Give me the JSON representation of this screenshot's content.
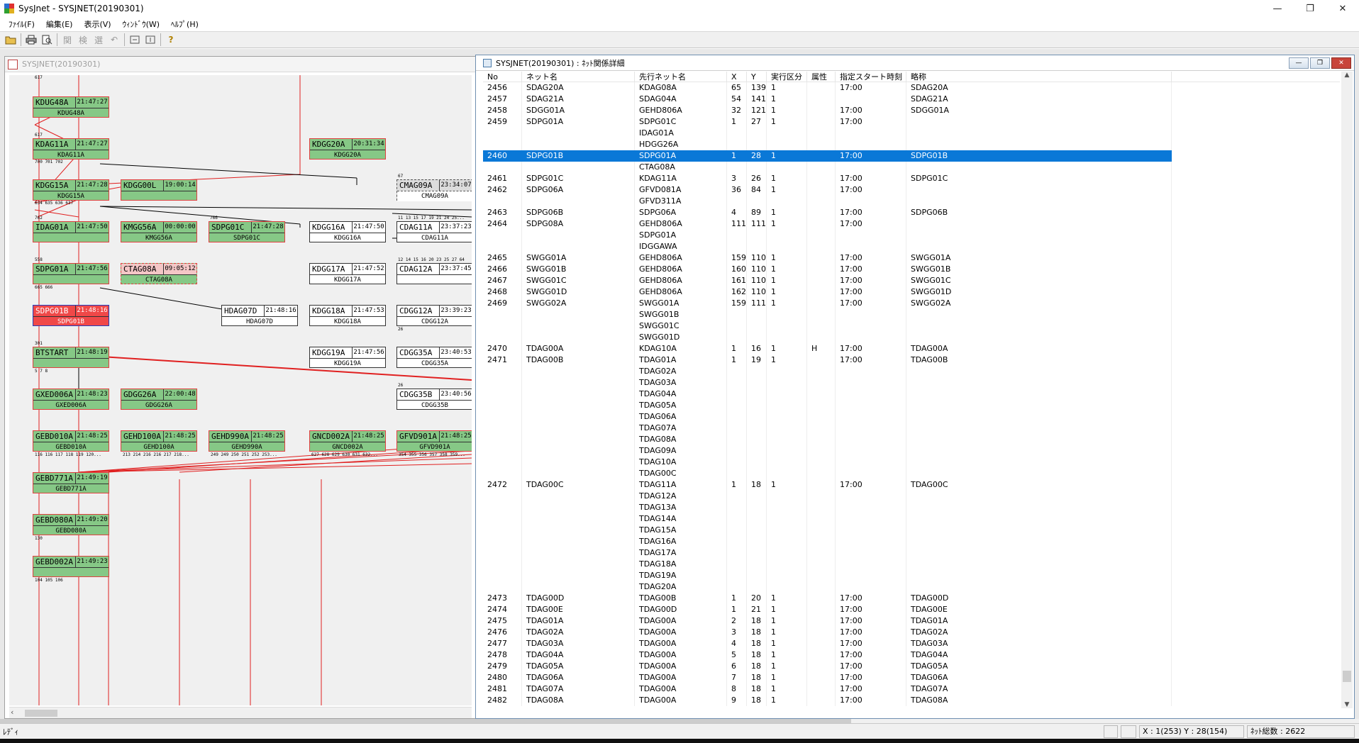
{
  "app": {
    "title": "SysJnet - SYSJNET(20190301)",
    "colors": {
      "accent": "#0a78d7",
      "node_green": "#86c886",
      "node_red": "#f04848",
      "line_red": "#e02020"
    }
  },
  "menu": [
    "ﾌｧｲﾙ(F)",
    "編集(E)",
    "表示(V)",
    "ｳｨﾝﾄﾞｳ(W)",
    "ﾍﾙﾌﾟ(H)"
  ],
  "toolbar": {
    "icons": [
      "open-folder-icon",
      "print-icon",
      "print-preview-icon",
      "relation-icon",
      "search-icon",
      "select-icon",
      "undo-icon",
      "box1-icon",
      "box2-icon",
      "help-icon"
    ],
    "glyphs": {
      "relation": "関",
      "search": "検",
      "select": "選",
      "undo": "↶",
      "help": "?"
    }
  },
  "left_window": {
    "title": "SYSJNET(20190301)",
    "nodes": [
      {
        "name": "KDUG48A",
        "time": "21:47:27",
        "sub": "KDUG48A",
        "style": "green"
      },
      {
        "name": "KDAG11A",
        "time": "21:47:27",
        "sub": "KDAG11A",
        "style": "green"
      },
      {
        "name": "KDGG20A",
        "time": "20:31:34",
        "sub": "KDGG20A",
        "style": "green"
      },
      {
        "name": "KDGG15A",
        "time": "21:47:28",
        "sub": "KDGG15A",
        "style": "green"
      },
      {
        "name": "KDGG00L",
        "time": "19:00:14",
        "sub": "",
        "style": "green"
      },
      {
        "name": "CMAG09A",
        "time": "23:34:07",
        "sub": "CMAG09A",
        "style": "dash"
      },
      {
        "name": "IDAG01A",
        "time": "21:47:50",
        "sub": "",
        "style": "green"
      },
      {
        "name": "KMGG56A",
        "time": "00:00:00",
        "sub": "KMGG56A",
        "style": "green"
      },
      {
        "name": "SDPG01C",
        "time": "21:47:28",
        "sub": "SDPG01C",
        "style": "green"
      },
      {
        "name": "KDGG16A",
        "time": "21:47:50",
        "sub": "KDGG16A",
        "style": "white"
      },
      {
        "name": "CDAG11A",
        "time": "23:37:23",
        "sub": "CDAG11A",
        "style": "white"
      },
      {
        "name": "SDPG01A",
        "time": "21:47:56",
        "sub": "",
        "style": "green"
      },
      {
        "name": "CTAG08A",
        "time": "09:05:12",
        "sub": "CTAG08A",
        "style": "pink"
      },
      {
        "name": "KDGG17A",
        "time": "21:47:52",
        "sub": "KDGG17A",
        "style": "white"
      },
      {
        "name": "CDAG12A",
        "time": "23:37:45",
        "sub": "",
        "style": "white"
      },
      {
        "name": "SDPG01B",
        "time": "21:48:16",
        "sub": "SDPG01B",
        "style": "red"
      },
      {
        "name": "HDAG07D",
        "time": "21:48:16",
        "sub": "HDAG07D",
        "style": "white"
      },
      {
        "name": "KDGG18A",
        "time": "21:47:53",
        "sub": "KDGG18A",
        "style": "white"
      },
      {
        "name": "CDGG12A",
        "time": "23:39:23",
        "sub": "CDGG12A",
        "style": "white"
      },
      {
        "name": "BTSTART",
        "time": "21:48:19",
        "sub": "",
        "style": "green"
      },
      {
        "name": "KDGG19A",
        "time": "21:47:56",
        "sub": "KDGG19A",
        "style": "white"
      },
      {
        "name": "CDGG35A",
        "time": "23:40:53",
        "sub": "CDGG35A",
        "style": "white"
      },
      {
        "name": "GXED006A",
        "time": "21:48:23",
        "sub": "GXED006A",
        "style": "green"
      },
      {
        "name": "GDGG26A",
        "time": "22:00:48",
        "sub": "GDGG26A",
        "style": "green"
      },
      {
        "name": "CDGG35B",
        "time": "23:40:56",
        "sub": "CDGG35B",
        "style": "white"
      },
      {
        "name": "GEBD010A",
        "time": "21:48:25",
        "sub": "GEBD010A",
        "style": "green"
      },
      {
        "name": "GEHD100A",
        "time": "21:48:25",
        "sub": "GEHD100A",
        "style": "green"
      },
      {
        "name": "GEHD990A",
        "time": "21:48:25",
        "sub": "GEHD990A",
        "style": "green"
      },
      {
        "name": "GNCD002A",
        "time": "21:48:25",
        "sub": "GNCD002A",
        "style": "green"
      },
      {
        "name": "GFVD901A",
        "time": "21:48:25",
        "sub": "GFVD901A",
        "style": "green"
      },
      {
        "name": "GEBD771A",
        "time": "21:49:19",
        "sub": "GEBD771A",
        "style": "green"
      },
      {
        "name": "GEBD080A",
        "time": "21:49:20",
        "sub": "GEBD080A",
        "style": "green"
      },
      {
        "name": "GEBD002A",
        "time": "21:49:23",
        "sub": "",
        "style": "green"
      }
    ],
    "labels": [
      "617",
      "617",
      "700 701 702",
      "67",
      "634 635 636 637",
      "11 13 15 17 19 21 24 25...",
      "762",
      "766",
      "558",
      "12 14 15 16 20 23 25 27 64",
      "665 666",
      "26",
      "301",
      "5 7 8",
      "26",
      "116 116 117 118 119 120...",
      "213 214 216 216 217 218...",
      "249 249 250 251 252 253...",
      "627 628 629 630 631 632...",
      "354 355 356 357 358 359...",
      "130",
      "104 105 106"
    ]
  },
  "right_window": {
    "title": "SYSJNET(20190301) : ﾈｯﾄ関係詳細",
    "columns": [
      "No",
      "ネット名",
      "先行ネット名",
      "X",
      "Y",
      "実行区分",
      "属性",
      "指定スタート時刻",
      "略称"
    ],
    "rows": [
      [
        "2456",
        "SDAG20A",
        "KDAG08A",
        "65",
        "139",
        "1",
        "",
        "17:00",
        "SDAG20A"
      ],
      [
        "2457",
        "SDAG21A",
        "SDAG04A",
        "54",
        "141",
        "1",
        "",
        "",
        "SDAG21A"
      ],
      [
        "2458",
        "SDGG01A",
        "GEHD806A",
        "32",
        "121",
        "1",
        "",
        "17:00",
        "SDGG01A"
      ],
      [
        "2459",
        "SDPG01A",
        "SDPG01C",
        "1",
        "27",
        "1",
        "",
        "17:00",
        ""
      ],
      [
        "",
        "",
        "IDAG01A",
        "",
        "",
        "",
        "",
        "",
        ""
      ],
      [
        "",
        "",
        "HDGG26A",
        "",
        "",
        "",
        "",
        "",
        ""
      ],
      [
        "2460",
        "SDPG01B",
        "SDPG01A",
        "1",
        "28",
        "1",
        "",
        "17:00",
        "SDPG01B"
      ],
      [
        "",
        "",
        "CTAG08A",
        "",
        "",
        "",
        "",
        "",
        ""
      ],
      [
        "2461",
        "SDPG01C",
        "KDAG11A",
        "3",
        "26",
        "1",
        "",
        "17:00",
        "SDPG01C"
      ],
      [
        "2462",
        "SDPG06A",
        "GFVD081A",
        "36",
        "84",
        "1",
        "",
        "17:00",
        ""
      ],
      [
        "",
        "",
        "GFVD311A",
        "",
        "",
        "",
        "",
        "",
        ""
      ],
      [
        "2463",
        "SDPG06B",
        "SDPG06A",
        "4",
        "89",
        "1",
        "",
        "17:00",
        "SDPG06B"
      ],
      [
        "2464",
        "SDPG08A",
        "GEHD806A",
        "111",
        "111",
        "1",
        "",
        "17:00",
        ""
      ],
      [
        "",
        "",
        "SDPG01A",
        "",
        "",
        "",
        "",
        "",
        ""
      ],
      [
        "",
        "",
        "IDGGAWA",
        "",
        "",
        "",
        "",
        "",
        ""
      ],
      [
        "2465",
        "SWGG01A",
        "GEHD806A",
        "159",
        "110",
        "1",
        "",
        "17:00",
        "SWGG01A"
      ],
      [
        "2466",
        "SWGG01B",
        "GEHD806A",
        "160",
        "110",
        "1",
        "",
        "17:00",
        "SWGG01B"
      ],
      [
        "2467",
        "SWGG01C",
        "GEHD806A",
        "161",
        "110",
        "1",
        "",
        "17:00",
        "SWGG01C"
      ],
      [
        "2468",
        "SWGG01D",
        "GEHD806A",
        "162",
        "110",
        "1",
        "",
        "17:00",
        "SWGG01D"
      ],
      [
        "2469",
        "SWGG02A",
        "SWGG01A",
        "159",
        "111",
        "1",
        "",
        "17:00",
        "SWGG02A"
      ],
      [
        "",
        "",
        "SWGG01B",
        "",
        "",
        "",
        "",
        "",
        ""
      ],
      [
        "",
        "",
        "SWGG01C",
        "",
        "",
        "",
        "",
        "",
        ""
      ],
      [
        "",
        "",
        "SWGG01D",
        "",
        "",
        "",
        "",
        "",
        ""
      ],
      [
        "2470",
        "TDAG00A",
        "KDAG10A",
        "1",
        "16",
        "1",
        "H",
        "17:00",
        "TDAG00A"
      ],
      [
        "2471",
        "TDAG00B",
        "TDAG01A",
        "1",
        "19",
        "1",
        "",
        "17:00",
        "TDAG00B"
      ],
      [
        "",
        "",
        "TDAG02A",
        "",
        "",
        "",
        "",
        "",
        ""
      ],
      [
        "",
        "",
        "TDAG03A",
        "",
        "",
        "",
        "",
        "",
        ""
      ],
      [
        "",
        "",
        "TDAG04A",
        "",
        "",
        "",
        "",
        "",
        ""
      ],
      [
        "",
        "",
        "TDAG05A",
        "",
        "",
        "",
        "",
        "",
        ""
      ],
      [
        "",
        "",
        "TDAG06A",
        "",
        "",
        "",
        "",
        "",
        ""
      ],
      [
        "",
        "",
        "TDAG07A",
        "",
        "",
        "",
        "",
        "",
        ""
      ],
      [
        "",
        "",
        "TDAG08A",
        "",
        "",
        "",
        "",
        "",
        ""
      ],
      [
        "",
        "",
        "TDAG09A",
        "",
        "",
        "",
        "",
        "",
        ""
      ],
      [
        "",
        "",
        "TDAG10A",
        "",
        "",
        "",
        "",
        "",
        ""
      ],
      [
        "",
        "",
        "TDAG00C",
        "",
        "",
        "",
        "",
        "",
        ""
      ],
      [
        "2472",
        "TDAG00C",
        "TDAG11A",
        "1",
        "18",
        "1",
        "",
        "17:00",
        "TDAG00C"
      ],
      [
        "",
        "",
        "TDAG12A",
        "",
        "",
        "",
        "",
        "",
        ""
      ],
      [
        "",
        "",
        "TDAG13A",
        "",
        "",
        "",
        "",
        "",
        ""
      ],
      [
        "",
        "",
        "TDAG14A",
        "",
        "",
        "",
        "",
        "",
        ""
      ],
      [
        "",
        "",
        "TDAG15A",
        "",
        "",
        "",
        "",
        "",
        ""
      ],
      [
        "",
        "",
        "TDAG16A",
        "",
        "",
        "",
        "",
        "",
        ""
      ],
      [
        "",
        "",
        "TDAG17A",
        "",
        "",
        "",
        "",
        "",
        ""
      ],
      [
        "",
        "",
        "TDAG18A",
        "",
        "",
        "",
        "",
        "",
        ""
      ],
      [
        "",
        "",
        "TDAG19A",
        "",
        "",
        "",
        "",
        "",
        ""
      ],
      [
        "",
        "",
        "TDAG20A",
        "",
        "",
        "",
        "",
        "",
        ""
      ],
      [
        "2473",
        "TDAG00D",
        "TDAG00B",
        "1",
        "20",
        "1",
        "",
        "17:00",
        "TDAG00D"
      ],
      [
        "2474",
        "TDAG00E",
        "TDAG00D",
        "1",
        "21",
        "1",
        "",
        "17:00",
        "TDAG00E"
      ],
      [
        "2475",
        "TDAG01A",
        "TDAG00A",
        "2",
        "18",
        "1",
        "",
        "17:00",
        "TDAG01A"
      ],
      [
        "2476",
        "TDAG02A",
        "TDAG00A",
        "3",
        "18",
        "1",
        "",
        "17:00",
        "TDAG02A"
      ],
      [
        "2477",
        "TDAG03A",
        "TDAG00A",
        "4",
        "18",
        "1",
        "",
        "17:00",
        "TDAG03A"
      ],
      [
        "2478",
        "TDAG04A",
        "TDAG00A",
        "5",
        "18",
        "1",
        "",
        "17:00",
        "TDAG04A"
      ],
      [
        "2479",
        "TDAG05A",
        "TDAG00A",
        "6",
        "18",
        "1",
        "",
        "17:00",
        "TDAG05A"
      ],
      [
        "2480",
        "TDAG06A",
        "TDAG00A",
        "7",
        "18",
        "1",
        "",
        "17:00",
        "TDAG06A"
      ],
      [
        "2481",
        "TDAG07A",
        "TDAG00A",
        "8",
        "18",
        "1",
        "",
        "17:00",
        "TDAG07A"
      ],
      [
        "2482",
        "TDAG08A",
        "TDAG00A",
        "9",
        "18",
        "1",
        "",
        "17:00",
        "TDAG08A"
      ]
    ],
    "selected_no": "2460"
  },
  "status": {
    "ready": "ﾚﾃﾞｨ",
    "coords": "X : 1(253)  Y : 28(154)",
    "net_total": "ﾈｯﾄ総数 : 2622"
  }
}
